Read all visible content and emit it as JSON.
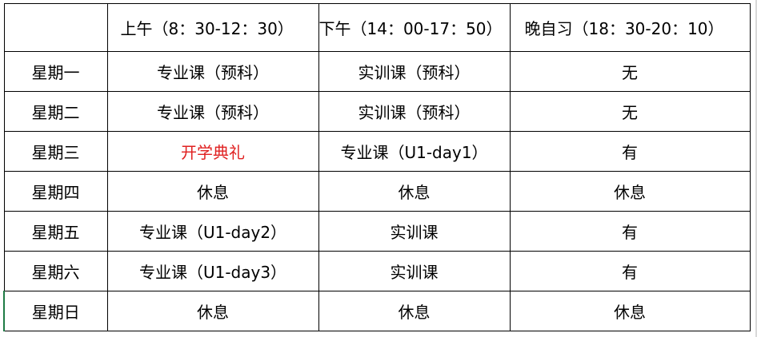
{
  "header": {
    "corner": "",
    "columns": [
      "上午（8：30-12：30）",
      "下午（14：00-17：50）",
      "晚自习（18：30-20：10）"
    ]
  },
  "rows": [
    {
      "day": "星期一",
      "cells": [
        "专业课（预科）",
        "实训课（预科）",
        "无"
      ]
    },
    {
      "day": "星期二",
      "cells": [
        "专业课（预科）",
        "实训课（预科）",
        "无"
      ]
    },
    {
      "day": "星期三",
      "cells": [
        "开学典礼",
        "专业课（U1-day1）",
        "有"
      ]
    },
    {
      "day": "星期四",
      "cells": [
        "休息",
        "休息",
        "休息"
      ]
    },
    {
      "day": "星期五",
      "cells": [
        "专业课（U1-day2）",
        "实训课",
        "有"
      ]
    },
    {
      "day": "星期六",
      "cells": [
        "专业课（U1-day3）",
        "实训课",
        "有"
      ]
    },
    {
      "day": "星期日",
      "cells": [
        "休息",
        "休息",
        "休息"
      ]
    }
  ],
  "colors": {
    "highlight_text": "#e02020",
    "selection_border": "#1e7b45",
    "grid_line": "#000000"
  }
}
